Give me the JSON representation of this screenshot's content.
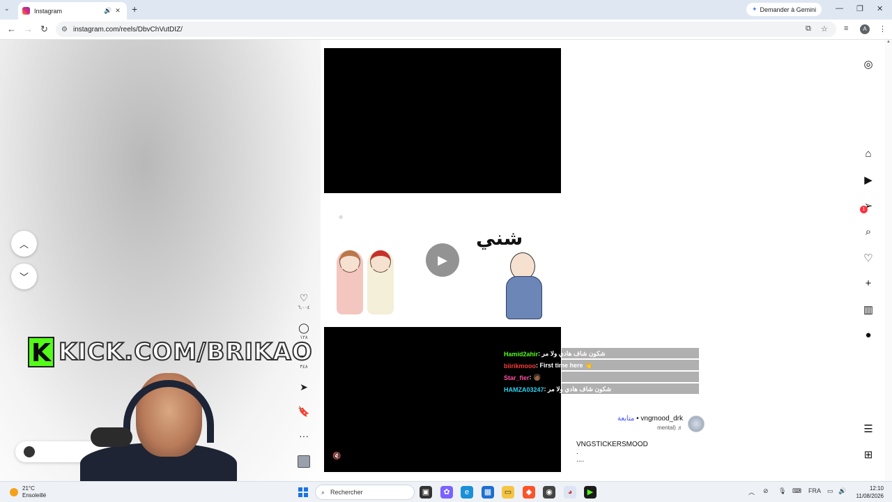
{
  "browser": {
    "tab_title": "Instagram",
    "new_tab_icon": "+",
    "gemini_label": "Demander à Gemini",
    "url": "instagram.com/reels/DbvChVutDIZ/",
    "profile_initial": "A"
  },
  "stream_overlay": {
    "kick_letter": "K",
    "kick_text": "KICK.COM/BRIKAO"
  },
  "reel": {
    "sticker_text": "شني",
    "chat": [
      {
        "user": "Hamid2ahir",
        "user_color": "#53fc18",
        "message": " : شكون شاف هادي ولا مر"
      },
      {
        "user": "biirikmooo",
        "user_color": "#ff3b3b",
        "message": " : First time here 👋"
      },
      {
        "user": "Star_fier",
        "user_color": "#ff4fa3",
        "message": " : 🧑🏾"
      },
      {
        "user": "HAMZA03247",
        "user_color": "#27d3f0",
        "message": " : شكون شاف هادي ولا مر"
      }
    ]
  },
  "actions": {
    "likes": "٦,٠٠٤",
    "comments": "١٢٨",
    "reposts": "٣٤٨",
    "shares": "٣٤٨"
  },
  "author": {
    "username": "vngmood_drk",
    "follow_label": "متابعة",
    "audio": "mental)",
    "caption_line1": "VNGSTICKERSMOOD",
    "caption_line2": ".",
    "caption_line3": "...."
  },
  "taskbar": {
    "temperature": "21°C",
    "weather": "Ensoleillé",
    "search_placeholder": "Rechercher",
    "language": "FRA",
    "time": "12:10",
    "date": "11/08/2026"
  },
  "rail_badge": "1"
}
